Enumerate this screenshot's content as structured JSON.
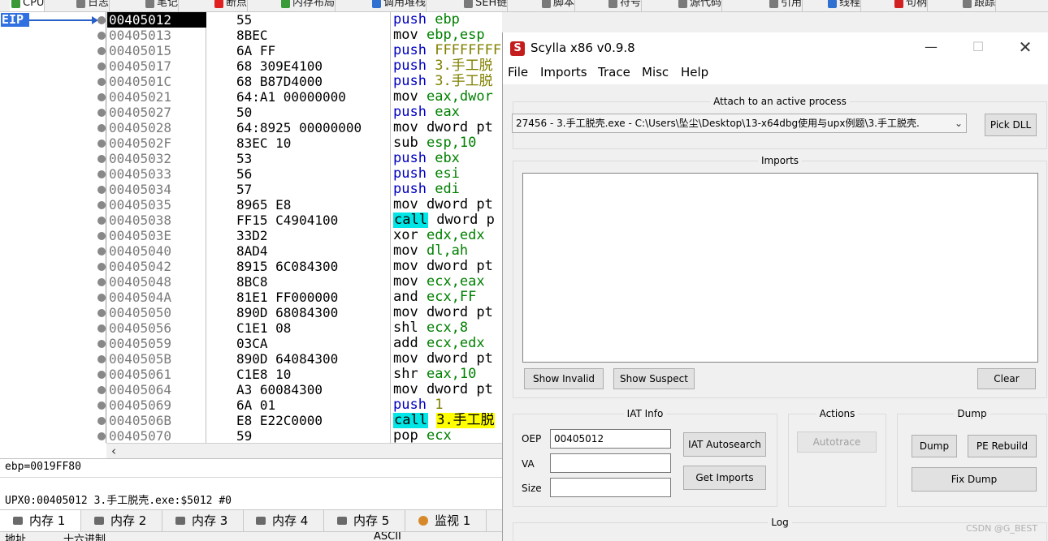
{
  "top_tabs": [
    {
      "label": "CPU",
      "icon": "cpu-icon",
      "color": "#3a9a3a",
      "active": true
    },
    {
      "label": "日志",
      "icon": "log-icon",
      "color": "#7a7a7a"
    },
    {
      "label": "笔记",
      "icon": "notes-icon",
      "color": "#7a7a7a"
    },
    {
      "label": "断点",
      "icon": "breakpoint-icon",
      "color": "#e02020"
    },
    {
      "label": "内存布局",
      "icon": "memory-map-icon",
      "color": "#3a9a3a"
    },
    {
      "label": "调用堆栈",
      "icon": "callstack-icon",
      "color": "#3070d0"
    },
    {
      "label": "SEH链",
      "icon": "seh-icon",
      "color": "#7a7a7a"
    },
    {
      "label": "脚本",
      "icon": "script-icon",
      "color": "#7a7a7a"
    },
    {
      "label": "符号",
      "icon": "symbols-icon",
      "color": "#7a7a7a"
    },
    {
      "label": "源代码",
      "icon": "source-icon",
      "color": "#7a7a7a"
    },
    {
      "label": "引用",
      "icon": "references-icon",
      "color": "#7a7a7a"
    },
    {
      "label": "线程",
      "icon": "threads-icon",
      "color": "#3070d0"
    },
    {
      "label": "句柄",
      "icon": "handles-icon",
      "color": "#d02020"
    },
    {
      "label": "跟踪",
      "icon": "trace-icon",
      "color": "#7a7a7a"
    }
  ],
  "cpu": {
    "eip_label": "EIP",
    "rows": [
      {
        "addr": "00405012",
        "bytes": "55",
        "mn": "push",
        "ops": "ebp",
        "cur": true
      },
      {
        "addr": "00405013",
        "bytes": "8BEC",
        "mn": "mov",
        "ops": "ebp,esp"
      },
      {
        "addr": "00405015",
        "bytes": "6A FF",
        "mn": "push",
        "ops": "FFFFFFFF",
        "opk": "imm"
      },
      {
        "addr": "00405017",
        "bytes": "68 309E4100",
        "mn": "push",
        "ops": "3.手工脱",
        "opk": "imm"
      },
      {
        "addr": "0040501C",
        "bytes": "68 B87D4000",
        "mn": "push",
        "ops": "3.手工脱",
        "opk": "imm"
      },
      {
        "addr": "00405021",
        "bytes": "64:A1 00000000",
        "mn": "mov",
        "ops": "eax,dwor"
      },
      {
        "addr": "00405027",
        "bytes": "50",
        "mn": "push",
        "ops": "eax"
      },
      {
        "addr": "00405028",
        "bytes": "64:8925 00000000",
        "mn": "mov",
        "ops": "dword pt",
        "opk": "ptr"
      },
      {
        "addr": "0040502F",
        "bytes": "83EC 10",
        "mn": "sub",
        "ops": "esp,10"
      },
      {
        "addr": "00405032",
        "bytes": "53",
        "mn": "push",
        "ops": "ebx"
      },
      {
        "addr": "00405033",
        "bytes": "56",
        "mn": "push",
        "ops": "esi"
      },
      {
        "addr": "00405034",
        "bytes": "57",
        "mn": "push",
        "ops": "edi"
      },
      {
        "addr": "00405035",
        "bytes": "8965 E8",
        "mn": "mov",
        "ops": "dword pt",
        "opk": "ptr"
      },
      {
        "addr": "00405038",
        "bytes": "FF15 C4904100",
        "mn": "call",
        "ops": "dword p",
        "opk": "ptr"
      },
      {
        "addr": "0040503E",
        "bytes": "33D2",
        "mn": "xor",
        "ops": "edx,edx"
      },
      {
        "addr": "00405040",
        "bytes": "8AD4",
        "mn": "mov",
        "ops": "dl,ah"
      },
      {
        "addr": "00405042",
        "bytes": "8915 6C084300",
        "mn": "mov",
        "ops": "dword pt",
        "opk": "ptr"
      },
      {
        "addr": "00405048",
        "bytes": "8BC8",
        "mn": "mov",
        "ops": "ecx,eax"
      },
      {
        "addr": "0040504A",
        "bytes": "81E1 FF000000",
        "mn": "and",
        "ops": "ecx,FF"
      },
      {
        "addr": "00405050",
        "bytes": "890D 68084300",
        "mn": "mov",
        "ops": "dword pt",
        "opk": "ptr"
      },
      {
        "addr": "00405056",
        "bytes": "C1E1 08",
        "mn": "shl",
        "ops": "ecx,8"
      },
      {
        "addr": "00405059",
        "bytes": "03CA",
        "mn": "add",
        "ops": "ecx,edx"
      },
      {
        "addr": "0040505B",
        "bytes": "890D 64084300",
        "mn": "mov",
        "ops": "dword pt",
        "opk": "ptr"
      },
      {
        "addr": "00405061",
        "bytes": "C1E8 10",
        "mn": "shr",
        "ops": "eax,10"
      },
      {
        "addr": "00405064",
        "bytes": "A3 60084300",
        "mn": "mov",
        "ops": "dword pt",
        "opk": "ptr"
      },
      {
        "addr": "00405069",
        "bytes": "6A 01",
        "mn": "push",
        "ops": "1",
        "opk": "imm"
      },
      {
        "addr": "0040506B",
        "bytes": "E8 E22C0000",
        "mn": "call",
        "ops": "3.手工脱",
        "opk": "callhl"
      },
      {
        "addr": "00405070",
        "bytes": "59",
        "mn": "pop",
        "ops": "ecx"
      }
    ]
  },
  "info": {
    "line1": "ebp=0019FF80",
    "line2": "UPX0:00405012 3.手工脱壳.exe:$5012 #0"
  },
  "bottom_tabs": [
    {
      "label": "内存 1",
      "icon": "memory-icon",
      "active": true
    },
    {
      "label": "内存 2",
      "icon": "memory-icon"
    },
    {
      "label": "内存 3",
      "icon": "memory-icon"
    },
    {
      "label": "内存 4",
      "icon": "memory-icon"
    },
    {
      "label": "内存 5",
      "icon": "memory-icon"
    },
    {
      "label": "监视 1",
      "icon": "watch-icon"
    }
  ],
  "dump_header": {
    "col1": "地址",
    "col2": "十六进制",
    "col3": "ASCII"
  },
  "scylla": {
    "title": "Scylla x86 v0.9.8",
    "app_icon": "S",
    "menu": [
      "File",
      "Imports",
      "Trace",
      "Misc",
      "Help"
    ],
    "attach_group": "Attach to an active process",
    "process": "27456 - 3.手工脱壳.exe - C:\\Users\\坠尘\\Desktop\\13-x64dbg使用与upx例题\\3.手工脱壳.",
    "pick_dll": "Pick DLL",
    "imports_group": "Imports",
    "show_invalid": "Show Invalid",
    "show_suspect": "Show Suspect",
    "clear": "Clear",
    "iat_group": "IAT Info",
    "oep_label": "OEP",
    "oep_value": "00405012",
    "va_label": "VA",
    "size_label": "Size",
    "iat_autosearch": "IAT Autosearch",
    "get_imports": "Get Imports",
    "actions_group": "Actions",
    "autotrace": "Autotrace",
    "dump_group": "Dump",
    "dump": "Dump",
    "pe_rebuild": "PE Rebuild",
    "fix_dump": "Fix Dump",
    "log_group": "Log"
  },
  "watermark": "CSDN @G_BEST"
}
